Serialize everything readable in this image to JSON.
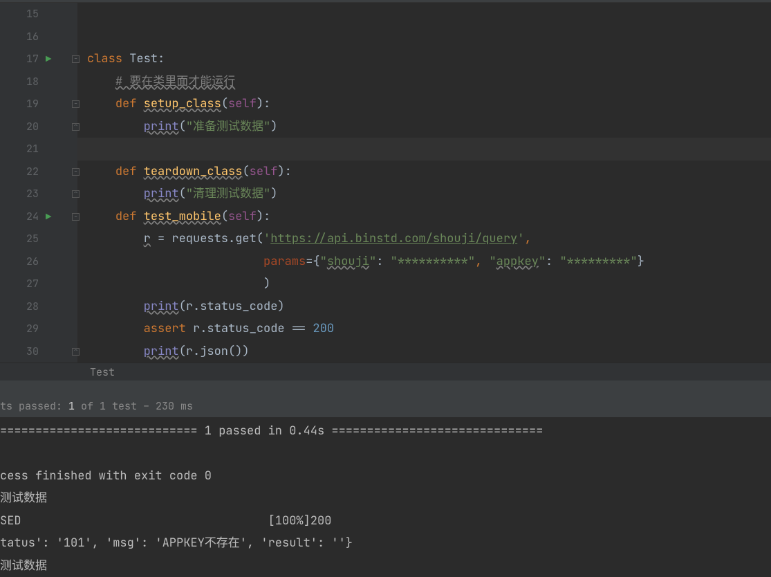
{
  "gutter": {
    "lines": [
      "15",
      "16",
      "17",
      "18",
      "19",
      "20",
      "21",
      "22",
      "23",
      "24",
      "25",
      "26",
      "27",
      "28",
      "29",
      "30"
    ],
    "run_markers": [
      {
        "line": 17
      },
      {
        "line": 24
      }
    ],
    "fold_markers": [
      {
        "line": 17,
        "glyph": "−"
      },
      {
        "line": 19,
        "glyph": "−"
      },
      {
        "line": 20,
        "glyph": "⌃"
      },
      {
        "line": 22,
        "glyph": "−"
      },
      {
        "line": 23,
        "glyph": "⌃"
      },
      {
        "line": 24,
        "glyph": "−"
      },
      {
        "line": 30,
        "glyph": "⌃"
      }
    ]
  },
  "code": {
    "highlight_line": 21,
    "tokens": {
      "17": [
        {
          "t": "class ",
          "c": "kw"
        },
        {
          "t": "Test",
          "c": "id"
        },
        {
          "t": ":",
          "c": "id"
        }
      ],
      "18": [
        {
          "t": "    ",
          "c": "id"
        },
        {
          "t": "# 要在类里面才能运行",
          "c": "cmt"
        }
      ],
      "19": [
        {
          "t": "    ",
          "c": "id"
        },
        {
          "t": "def ",
          "c": "kw"
        },
        {
          "t": "setup_class",
          "c": "def"
        },
        {
          "t": "(",
          "c": "id"
        },
        {
          "t": "self",
          "c": "self"
        },
        {
          "t": "):",
          "c": "id"
        }
      ],
      "20": [
        {
          "t": "        ",
          "c": "id"
        },
        {
          "t": "print",
          "c": "builtin"
        },
        {
          "t": "(",
          "c": "id"
        },
        {
          "t": "\"准备测试数据\"",
          "c": "str"
        },
        {
          "t": ")",
          "c": "id"
        }
      ],
      "21": [
        {
          "t": " ",
          "c": "id"
        }
      ],
      "22": [
        {
          "t": "    ",
          "c": "id"
        },
        {
          "t": "def ",
          "c": "kw"
        },
        {
          "t": "teardown_class",
          "c": "def"
        },
        {
          "t": "(",
          "c": "id"
        },
        {
          "t": "self",
          "c": "self"
        },
        {
          "t": "):",
          "c": "id"
        }
      ],
      "23": [
        {
          "t": "        ",
          "c": "id"
        },
        {
          "t": "print",
          "c": "builtin"
        },
        {
          "t": "(",
          "c": "id"
        },
        {
          "t": "\"清理测试数据\"",
          "c": "str"
        },
        {
          "t": ")",
          "c": "id"
        }
      ],
      "24": [
        {
          "t": "    ",
          "c": "id"
        },
        {
          "t": "def ",
          "c": "kw"
        },
        {
          "t": "test_mobile",
          "c": "def"
        },
        {
          "t": "(",
          "c": "id"
        },
        {
          "t": "self",
          "c": "self"
        },
        {
          "t": "):",
          "c": "id"
        }
      ],
      "25": [
        {
          "t": "        ",
          "c": "id"
        },
        {
          "t": "r",
          "c": "wavy"
        },
        {
          "t": " = requests.get(",
          "c": "id"
        },
        {
          "t": "'",
          "c": "str"
        },
        {
          "t": "https://api.binstd.com/shouji/query",
          "c": "url"
        },
        {
          "t": "'",
          "c": "str"
        },
        {
          "t": ",",
          "c": "kw"
        }
      ],
      "26": [
        {
          "t": "                         ",
          "c": "id"
        },
        {
          "t": "params",
          "c": "kwarg"
        },
        {
          "t": "={",
          "c": "id"
        },
        {
          "t": "\"",
          "c": "str"
        },
        {
          "t": "shouji",
          "c": "str wavy"
        },
        {
          "t": "\"",
          "c": "str"
        },
        {
          "t": ": ",
          "c": "id"
        },
        {
          "t": "\"**********\"",
          "c": "str"
        },
        {
          "t": ", ",
          "c": "kw"
        },
        {
          "t": "\"",
          "c": "str"
        },
        {
          "t": "appkey",
          "c": "str wavy"
        },
        {
          "t": "\"",
          "c": "str"
        },
        {
          "t": ": ",
          "c": "id"
        },
        {
          "t": "\"*********\"",
          "c": "str"
        },
        {
          "t": "}",
          "c": "id"
        }
      ],
      "27": [
        {
          "t": "                         )",
          "c": "id"
        }
      ],
      "28": [
        {
          "t": "        ",
          "c": "id"
        },
        {
          "t": "print",
          "c": "builtin"
        },
        {
          "t": "(r.status_code)",
          "c": "id"
        }
      ],
      "29": [
        {
          "t": "        ",
          "c": "id"
        },
        {
          "t": "assert ",
          "c": "kw"
        },
        {
          "t": "r.status_code == ",
          "c": "id"
        },
        {
          "t": "200",
          "c": "num"
        }
      ],
      "30": [
        {
          "t": "        ",
          "c": "id"
        },
        {
          "t": "print",
          "c": "builtin"
        },
        {
          "t": "(r.json())",
          "c": "id"
        }
      ]
    }
  },
  "crumb": "Test",
  "status": {
    "prefix": "ts passed: ",
    "count": "1",
    "suffix": " of 1 test – 230 ms"
  },
  "console": {
    "lines": [
      "============================ 1 passed in 0.44s ==============================",
      "",
      "cess finished with exit code 0",
      "测试数据",
      "SED                                   [100%]200",
      "tatus': '101', 'msg': 'APPKEY不存在', 'result': ''}",
      "测试数据"
    ]
  }
}
